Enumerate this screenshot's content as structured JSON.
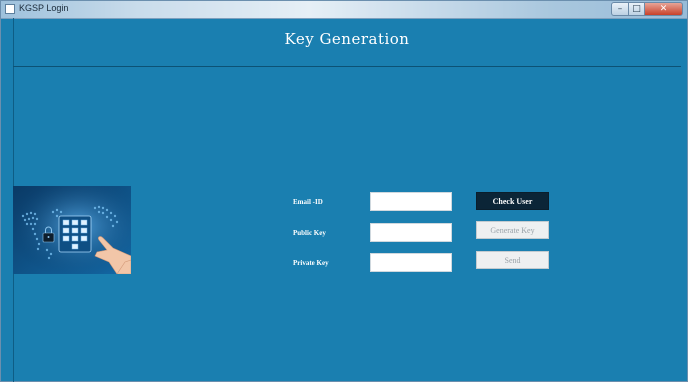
{
  "window": {
    "title": "KGSP Login"
  },
  "header": {
    "title": "Key Generation"
  },
  "form": {
    "email_label": "Email -ID",
    "public_key_label": "Public Key",
    "private_key_label": "Private Key",
    "email_value": "",
    "public_key_value": "",
    "private_key_value": ""
  },
  "buttons": {
    "check_user": "Check User",
    "generate_key": "Generate Key",
    "send": "Send"
  },
  "colors": {
    "background": "#1a7fb0",
    "primary_button": "#0b2537",
    "disabled_button": "#eef0f1"
  }
}
